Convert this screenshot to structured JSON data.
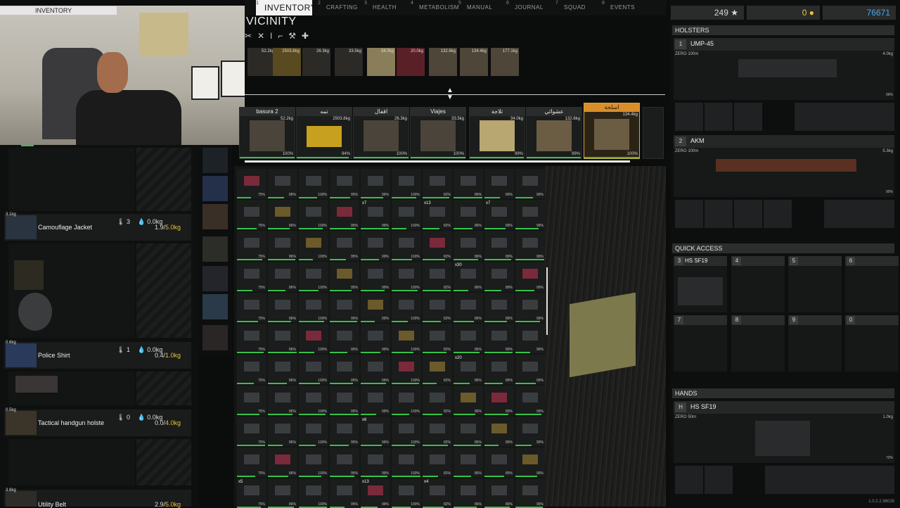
{
  "tabs": [
    {
      "num": "1",
      "label": "INVENTORY"
    },
    {
      "num": "2",
      "label": "CRAFTING"
    },
    {
      "num": "3",
      "label": "HEALTH"
    },
    {
      "num": "4",
      "label": "METABOLISM"
    },
    {
      "num": "5",
      "label": "MANUAL"
    },
    {
      "num": "6",
      "label": "JOURNAL"
    },
    {
      "num": "7",
      "label": "SQUAD"
    },
    {
      "num": "8",
      "label": "EVENTS"
    }
  ],
  "webcam_overlay_label": "INVENTORY",
  "vicinity": {
    "title": "VICINITY",
    "row_weights": [
      "52.2kg",
      "2503.8kg",
      "26.3kg",
      "33.5kg",
      "34.0kg",
      "20.0kg",
      "132.6kg",
      "134.4kg",
      "177.1kg"
    ],
    "containers": [
      {
        "name": "basura 2",
        "weight": "52.2kg",
        "pct": "100%"
      },
      {
        "name": "تمه",
        "weight": "2503.8kg",
        "pct": "94%"
      },
      {
        "name": "اقفال",
        "weight": "26.3kg",
        "pct": "100%"
      },
      {
        "name": "Viajes",
        "weight": "33.5kg",
        "pct": "100%"
      },
      {
        "name": "ثلاجة",
        "weight": "34.0kg",
        "pct": "99%"
      },
      {
        "name": "عشوائي",
        "weight": "132.6kg",
        "pct": "99%"
      },
      {
        "name": "اسلحة",
        "weight": "134.4kg",
        "pct": "100%"
      }
    ]
  },
  "gear": [
    {
      "name": "Camouflage Jacket",
      "weight": "3.1kg",
      "stat_top": "3",
      "stat_bottom": "0.0kg",
      "cap_used": "1.9/",
      "cap_max": "5.0kg"
    },
    {
      "name": "Police Shirt",
      "weight": "0.6kg",
      "stat_top": "1",
      "stat_bottom": "0.0kg",
      "cap_used": "0.4/",
      "cap_max": "1.0kg"
    },
    {
      "name": "Tactical handgun holste",
      "weight": "0.5kg",
      "stat_top": "0",
      "stat_bottom": "0.0kg",
      "cap_used": "0.0/",
      "cap_max": "4.0kg"
    },
    {
      "name": "Utility Belt",
      "weight": "3.8kg",
      "stat_top": "",
      "stat_bottom": "",
      "cap_used": "2.9/",
      "cap_max": "5.0kg"
    }
  ],
  "currency": {
    "stars": "249",
    "gold": "0",
    "money": "76671"
  },
  "holsters": {
    "title": "HOLSTERS",
    "slots": [
      {
        "num": "1",
        "name": "UMP-45",
        "zero": "ZERO 100m",
        "weight": "4.0kg",
        "pct": "99%"
      },
      {
        "num": "2",
        "name": "AKM",
        "zero": "ZERO 100m",
        "weight": "5.3kg",
        "pct": "90%"
      }
    ]
  },
  "quick_access": {
    "title": "QUICK ACCESS",
    "slots": [
      {
        "num": "3",
        "name": "HS SF19"
      },
      {
        "num": "4",
        "name": ""
      },
      {
        "num": "5",
        "name": ""
      },
      {
        "num": "6",
        "name": ""
      },
      {
        "num": "7",
        "name": ""
      },
      {
        "num": "8",
        "name": ""
      },
      {
        "num": "9",
        "name": ""
      },
      {
        "num": "0",
        "name": ""
      }
    ]
  },
  "hands": {
    "title": "HANDS",
    "num": "H",
    "name": "HS SF19",
    "zero": "ZERO 50m",
    "weight": "1.0kg",
    "pct": "72%"
  },
  "grid_badges": [
    "x7",
    "x13",
    "x7",
    "x30",
    "x20",
    "x6",
    "x5",
    "x13",
    "x4"
  ],
  "version": "1.0.2.2.98026",
  "colors": {
    "accent": "#d98e2a",
    "durability": "#36c24a",
    "capacity": "#e8c23b",
    "money": "#4aa8e8"
  }
}
